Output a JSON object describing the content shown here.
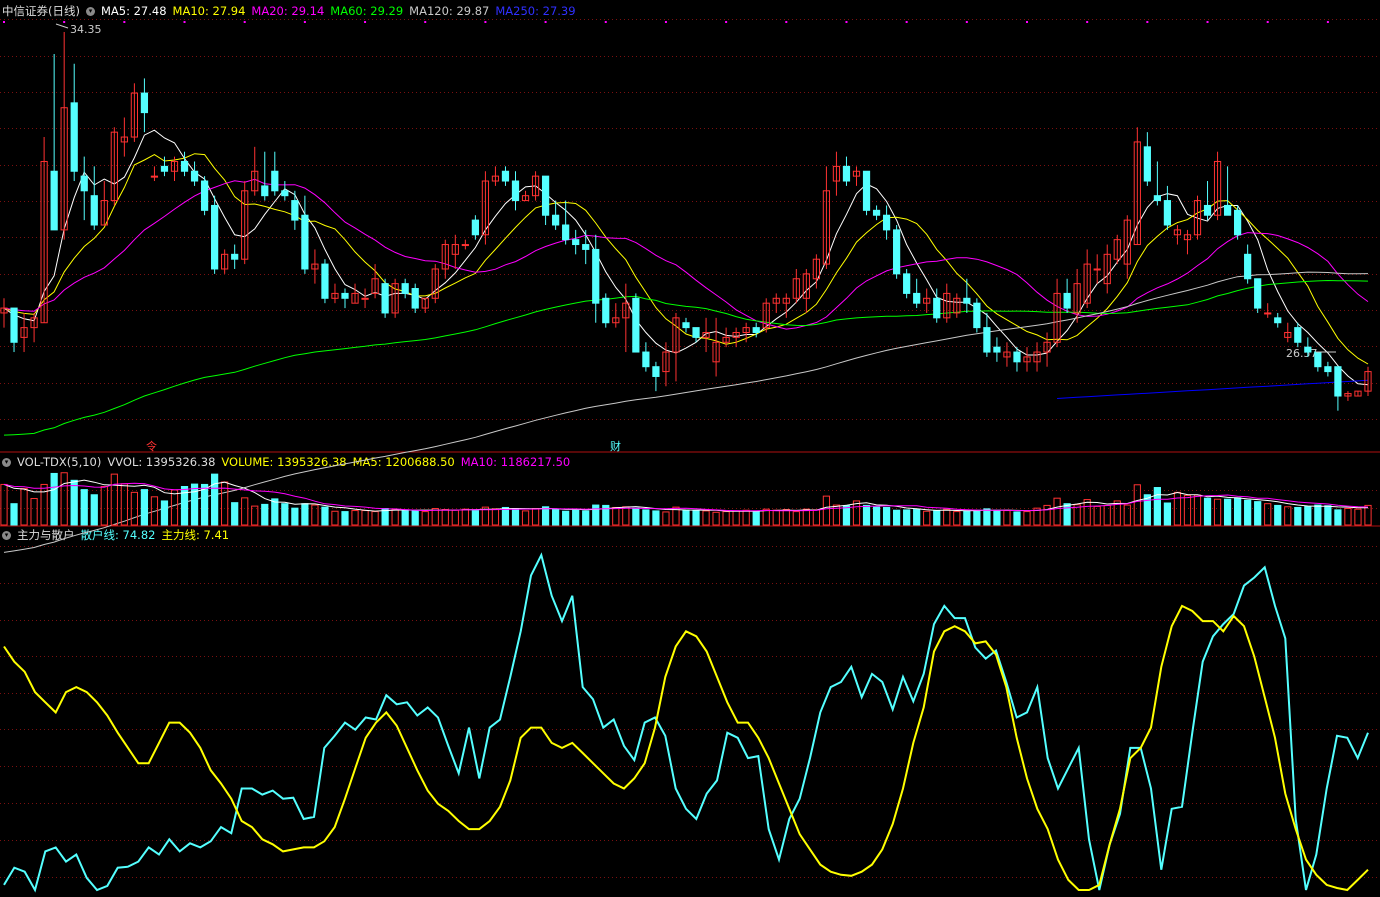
{
  "colors": {
    "bg": "#000000",
    "up": "#ff3232",
    "down": "#54ffff",
    "grid": "#7a1010",
    "ma5": "#ffffff",
    "ma10": "#ffff00",
    "ma20": "#ff00ff",
    "ma60": "#00ff00",
    "ma120": "#c8c8c8",
    "ma250": "#0000ff",
    "retail": "#54ffff",
    "main": "#ffff00"
  },
  "price_panel": {
    "title": "中信证券(日线)",
    "ma5_label": "MA5: 27.48",
    "ma10_label": "MA10: 27.94",
    "ma20_label": "MA20: 29.14",
    "ma60_label": "MA60: 29.29",
    "ma120_label": "MA120: 29.87",
    "ma250_label": "MA250: 27.39",
    "high_label": "34.35",
    "low_label": "26.57",
    "marker_a": "令",
    "marker_b": "财"
  },
  "volume_panel": {
    "title": "VOL-TDX(5,10)",
    "vvol_label": "VVOL: 1395326.38",
    "volume_label": "VOLUME: 1395326.38",
    "ma5_label": "MA5: 1200688.50",
    "ma10_label": "MA10: 1186217.50"
  },
  "indicator_panel": {
    "title": "主力与散户",
    "retail_label": "散户线: 74.82",
    "main_label": "主力线: 7.41"
  },
  "chart_data": {
    "type": "candlestick",
    "ylim": [
      26.0,
      34.8
    ],
    "ohlc": [
      [
        28.6,
        28.9,
        28.3,
        28.7
      ],
      [
        28.7,
        28.7,
        27.8,
        28.0
      ],
      [
        28.1,
        28.6,
        27.8,
        28.3
      ],
      [
        28.3,
        28.6,
        28.0,
        28.5
      ],
      [
        28.4,
        32.2,
        28.4,
        31.7
      ],
      [
        31.5,
        33.9,
        30.3,
        30.3
      ],
      [
        30.3,
        34.35,
        30.1,
        32.8
      ],
      [
        32.9,
        33.7,
        31.3,
        31.5
      ],
      [
        31.4,
        31.8,
        30.5,
        31.1
      ],
      [
        31.0,
        31.6,
        30.3,
        30.4
      ],
      [
        30.4,
        31.3,
        30.4,
        30.9
      ],
      [
        30.9,
        32.4,
        30.8,
        32.3
      ],
      [
        32.1,
        32.6,
        31.8,
        32.2
      ],
      [
        32.2,
        33.3,
        32.1,
        33.1
      ],
      [
        33.1,
        33.4,
        32.3,
        32.7
      ],
      [
        31.4,
        31.6,
        31.3,
        31.4
      ],
      [
        31.6,
        31.8,
        31.4,
        31.5
      ],
      [
        31.5,
        31.8,
        31.3,
        31.7
      ],
      [
        31.7,
        31.9,
        31.4,
        31.5
      ],
      [
        31.5,
        31.7,
        31.2,
        31.3
      ],
      [
        31.3,
        31.4,
        30.6,
        30.7
      ],
      [
        30.8,
        31.0,
        29.4,
        29.5
      ],
      [
        29.5,
        29.9,
        29.4,
        29.8
      ],
      [
        29.8,
        30.0,
        29.5,
        29.7
      ],
      [
        29.7,
        31.3,
        29.6,
        31.1
      ],
      [
        31.1,
        32.0,
        31.0,
        31.5
      ],
      [
        31.2,
        31.9,
        30.9,
        31.0
      ],
      [
        31.5,
        31.9,
        31.0,
        31.1
      ],
      [
        31.1,
        31.3,
        30.9,
        31.0
      ],
      [
        30.9,
        31.1,
        30.3,
        30.5
      ],
      [
        30.6,
        31.0,
        29.4,
        29.5
      ],
      [
        29.5,
        29.9,
        29.2,
        29.6
      ],
      [
        29.6,
        29.7,
        28.8,
        28.9
      ],
      [
        28.9,
        29.2,
        28.8,
        29.0
      ],
      [
        29.0,
        29.1,
        28.7,
        28.9
      ],
      [
        28.8,
        29.2,
        28.8,
        29.0
      ],
      [
        28.9,
        29.1,
        28.7,
        28.9
      ],
      [
        29.0,
        29.6,
        28.9,
        29.3
      ],
      [
        29.2,
        29.3,
        28.5,
        28.6
      ],
      [
        28.6,
        29.3,
        28.5,
        29.2
      ],
      [
        29.2,
        29.3,
        28.9,
        29.0
      ],
      [
        29.1,
        29.2,
        28.6,
        28.7
      ],
      [
        28.7,
        28.9,
        28.6,
        28.9
      ],
      [
        28.9,
        29.6,
        28.8,
        29.5
      ],
      [
        29.5,
        30.1,
        29.3,
        30.0
      ],
      [
        29.8,
        30.2,
        29.5,
        30.0
      ],
      [
        30.0,
        30.1,
        29.9,
        30.0
      ],
      [
        30.5,
        30.6,
        30.1,
        30.2
      ],
      [
        30.2,
        31.5,
        30.0,
        31.3
      ],
      [
        31.3,
        31.6,
        31.2,
        31.4
      ],
      [
        31.5,
        31.6,
        31.2,
        31.3
      ],
      [
        31.3,
        31.5,
        30.7,
        30.9
      ],
      [
        30.9,
        31.1,
        30.9,
        31.0
      ],
      [
        31.0,
        31.5,
        30.9,
        31.4
      ],
      [
        31.4,
        31.4,
        30.4,
        30.6
      ],
      [
        30.6,
        30.9,
        30.3,
        30.4
      ],
      [
        30.4,
        30.9,
        30.0,
        30.1
      ],
      [
        30.1,
        30.3,
        29.8,
        30.0
      ],
      [
        30.0,
        30.3,
        29.6,
        29.9
      ],
      [
        29.9,
        30.2,
        28.4,
        28.8
      ],
      [
        28.9,
        29.0,
        28.3,
        28.4
      ],
      [
        28.4,
        28.8,
        28.3,
        28.5
      ],
      [
        28.5,
        29.2,
        27.8,
        28.8
      ],
      [
        28.9,
        29.0,
        27.8,
        27.8
      ],
      [
        27.8,
        28.0,
        27.4,
        27.5
      ],
      [
        27.5,
        27.6,
        27.0,
        27.3
      ],
      [
        27.4,
        28.0,
        27.1,
        27.8
      ],
      [
        27.8,
        28.6,
        27.2,
        28.5
      ],
      [
        28.4,
        28.5,
        28.2,
        28.3
      ],
      [
        28.3,
        28.3,
        28.0,
        28.1
      ],
      [
        28.1,
        28.5,
        27.8,
        28.2
      ],
      [
        27.6,
        28.5,
        27.3,
        28.0
      ],
      [
        28.0,
        28.3,
        27.9,
        28.1
      ],
      [
        28.1,
        28.3,
        27.9,
        28.2
      ],
      [
        28.2,
        28.4,
        28.0,
        28.3
      ],
      [
        28.3,
        28.4,
        28.1,
        28.2
      ],
      [
        28.3,
        28.9,
        28.2,
        28.8
      ],
      [
        28.8,
        29.0,
        28.6,
        28.9
      ],
      [
        28.8,
        29.0,
        28.5,
        28.9
      ],
      [
        28.9,
        29.5,
        28.8,
        29.3
      ],
      [
        28.9,
        29.5,
        28.6,
        29.4
      ],
      [
        29.3,
        29.8,
        29.1,
        29.7
      ],
      [
        29.6,
        31.6,
        29.5,
        31.1
      ],
      [
        31.3,
        31.9,
        31.0,
        31.6
      ],
      [
        31.6,
        31.8,
        31.2,
        31.3
      ],
      [
        31.4,
        31.6,
        31.2,
        31.5
      ],
      [
        31.5,
        31.5,
        30.6,
        30.7
      ],
      [
        30.7,
        30.8,
        30.5,
        30.6
      ],
      [
        30.6,
        30.8,
        30.1,
        30.3
      ],
      [
        30.3,
        30.4,
        29.3,
        29.4
      ],
      [
        29.4,
        29.5,
        28.9,
        29.0
      ],
      [
        29.0,
        29.3,
        28.7,
        28.8
      ],
      [
        28.8,
        29.1,
        28.6,
        28.9
      ],
      [
        28.9,
        29.1,
        28.4,
        28.5
      ],
      [
        28.5,
        29.2,
        28.4,
        29.0
      ],
      [
        28.6,
        29.0,
        28.5,
        28.9
      ],
      [
        28.9,
        29.3,
        28.6,
        28.8
      ],
      [
        28.8,
        28.9,
        28.2,
        28.3
      ],
      [
        28.3,
        28.6,
        27.7,
        27.8
      ],
      [
        27.9,
        28.1,
        27.6,
        27.8
      ],
      [
        27.7,
        28.0,
        27.5,
        27.8
      ],
      [
        27.8,
        27.9,
        27.4,
        27.6
      ],
      [
        27.6,
        27.9,
        27.4,
        27.7
      ],
      [
        27.6,
        28.0,
        27.4,
        27.8
      ],
      [
        27.8,
        28.2,
        27.5,
        28.0
      ],
      [
        28.0,
        29.3,
        27.9,
        29.0
      ],
      [
        29.0,
        29.3,
        28.6,
        28.7
      ],
      [
        28.6,
        29.5,
        28.4,
        29.2
      ],
      [
        28.8,
        29.9,
        28.7,
        29.6
      ],
      [
        29.5,
        29.8,
        29.2,
        29.5
      ],
      [
        29.2,
        30.0,
        29.0,
        29.8
      ],
      [
        29.7,
        30.2,
        29.6,
        30.1
      ],
      [
        29.6,
        30.6,
        29.3,
        30.5
      ],
      [
        30.0,
        32.4,
        30.0,
        32.1
      ],
      [
        32.0,
        32.3,
        31.2,
        31.3
      ],
      [
        31.0,
        31.7,
        30.8,
        30.9
      ],
      [
        30.9,
        31.2,
        30.3,
        30.4
      ],
      [
        30.2,
        30.4,
        30.0,
        30.3
      ],
      [
        30.1,
        30.3,
        29.8,
        30.2
      ],
      [
        30.2,
        31.0,
        30.1,
        30.9
      ],
      [
        30.8,
        31.3,
        30.5,
        30.6
      ],
      [
        30.6,
        31.9,
        30.5,
        31.7
      ],
      [
        30.8,
        31.6,
        30.7,
        30.6
      ],
      [
        30.7,
        30.8,
        30.1,
        30.2
      ],
      [
        29.8,
        30.0,
        29.2,
        29.3
      ],
      [
        29.3,
        29.3,
        28.6,
        28.7
      ],
      [
        28.6,
        28.8,
        28.5,
        28.6
      ],
      [
        28.5,
        28.6,
        28.3,
        28.4
      ],
      [
        28.1,
        28.4,
        28.0,
        28.2
      ],
      [
        28.3,
        28.4,
        27.9,
        28.0
      ],
      [
        27.9,
        28.1,
        27.7,
        27.8
      ],
      [
        27.8,
        27.8,
        27.4,
        27.5
      ],
      [
        27.5,
        27.6,
        27.3,
        27.4
      ],
      [
        27.5,
        27.5,
        26.6,
        26.9
      ],
      [
        26.9,
        27.0,
        26.8,
        26.95
      ],
      [
        26.9,
        27.0,
        26.9,
        27.0
      ],
      [
        27.0,
        27.5,
        26.9,
        27.4
      ]
    ],
    "volume": [
      118,
      62,
      106,
      77,
      118,
      150,
      152,
      130,
      103,
      88,
      112,
      148,
      120,
      95,
      103,
      82,
      70,
      102,
      112,
      119,
      118,
      148,
      125,
      65,
      79,
      55,
      60,
      76,
      62,
      49,
      62,
      58,
      52,
      40,
      39,
      42,
      42,
      39,
      48,
      45,
      44,
      41,
      39,
      48,
      45,
      43,
      46,
      42,
      52,
      47,
      51,
      48,
      41,
      48,
      53,
      45,
      40,
      43,
      41,
      58,
      57,
      51,
      53,
      49,
      44,
      41,
      38,
      52,
      43,
      42,
      41,
      37,
      39,
      41,
      43,
      40,
      46,
      43,
      45,
      39,
      46,
      44,
      84,
      58,
      56,
      70,
      57,
      52,
      51,
      43,
      44,
      45,
      40,
      41,
      46,
      39,
      41,
      43,
      47,
      43,
      42,
      38,
      39,
      49,
      57,
      78,
      62,
      59,
      74,
      54,
      57,
      70,
      58,
      117,
      88,
      109,
      64,
      95,
      86,
      87,
      78,
      75,
      75,
      79,
      72,
      68,
      62,
      57,
      53,
      51,
      54,
      58,
      56,
      44,
      48,
      46,
      57
    ],
    "vol_ylim": [
      0,
      160
    ],
    "retail": [
      5,
      22,
      18,
      0,
      38,
      42,
      28,
      35,
      12,
      0,
      4,
      22,
      23,
      28,
      42,
      35,
      50,
      38,
      46,
      42,
      48,
      62,
      56,
      100,
      100,
      94,
      98,
      90,
      91,
      70,
      72,
      140,
      152,
      165,
      158,
      170,
      168,
      192,
      183,
      185,
      172,
      180,
      170,
      142,
      115,
      160,
      110,
      160,
      168,
      210,
      255,
      310,
      330,
      290,
      265,
      290,
      200,
      188,
      160,
      168,
      142,
      128,
      165,
      170,
      152,
      100,
      80,
      70,
      95,
      108,
      155,
      150,
      130,
      132,
      60,
      30,
      70,
      90,
      130,
      175,
      200,
      205,
      220,
      190,
      213,
      205,
      178,
      210,
      186,
      213,
      262,
      280,
      268,
      268,
      239,
      228,
      236,
      205,
      170,
      175,
      200,
      130,
      100,
      120,
      140,
      50,
      0,
      45,
      75,
      140,
      140,
      100,
      20,
      80,
      82,
      155,
      225,
      250,
      262,
      272,
      300,
      308,
      318,
      280,
      248,
      70,
      0,
      35,
      100,
      152,
      150,
      130,
      155
    ],
    "main": [
      240,
      225,
      215,
      195,
      185,
      175,
      195,
      200,
      195,
      185,
      172,
      155,
      140,
      125,
      125,
      145,
      165,
      165,
      155,
      140,
      118,
      105,
      90,
      68,
      62,
      50,
      45,
      38,
      40,
      42,
      42,
      48,
      62,
      90,
      120,
      150,
      165,
      175,
      162,
      140,
      118,
      98,
      85,
      78,
      68,
      60,
      60,
      68,
      82,
      108,
      150,
      160,
      160,
      145,
      140,
      145,
      135,
      125,
      115,
      105,
      100,
      110,
      125,
      160,
      210,
      240,
      255,
      250,
      235,
      210,
      185,
      165,
      165,
      150,
      130,
      105,
      80,
      55,
      40,
      25,
      18,
      15,
      14,
      18,
      25,
      40,
      65,
      100,
      145,
      180,
      235,
      255,
      260,
      255,
      243,
      245,
      232,
      200,
      150,
      110,
      80,
      60,
      30,
      10,
      0,
      0,
      5,
      45,
      80,
      130,
      140,
      160,
      220,
      260,
      280,
      275,
      265,
      265,
      255,
      270,
      260,
      230,
      190,
      150,
      95,
      60,
      30,
      15,
      5,
      2,
      0,
      10,
      20
    ]
  }
}
